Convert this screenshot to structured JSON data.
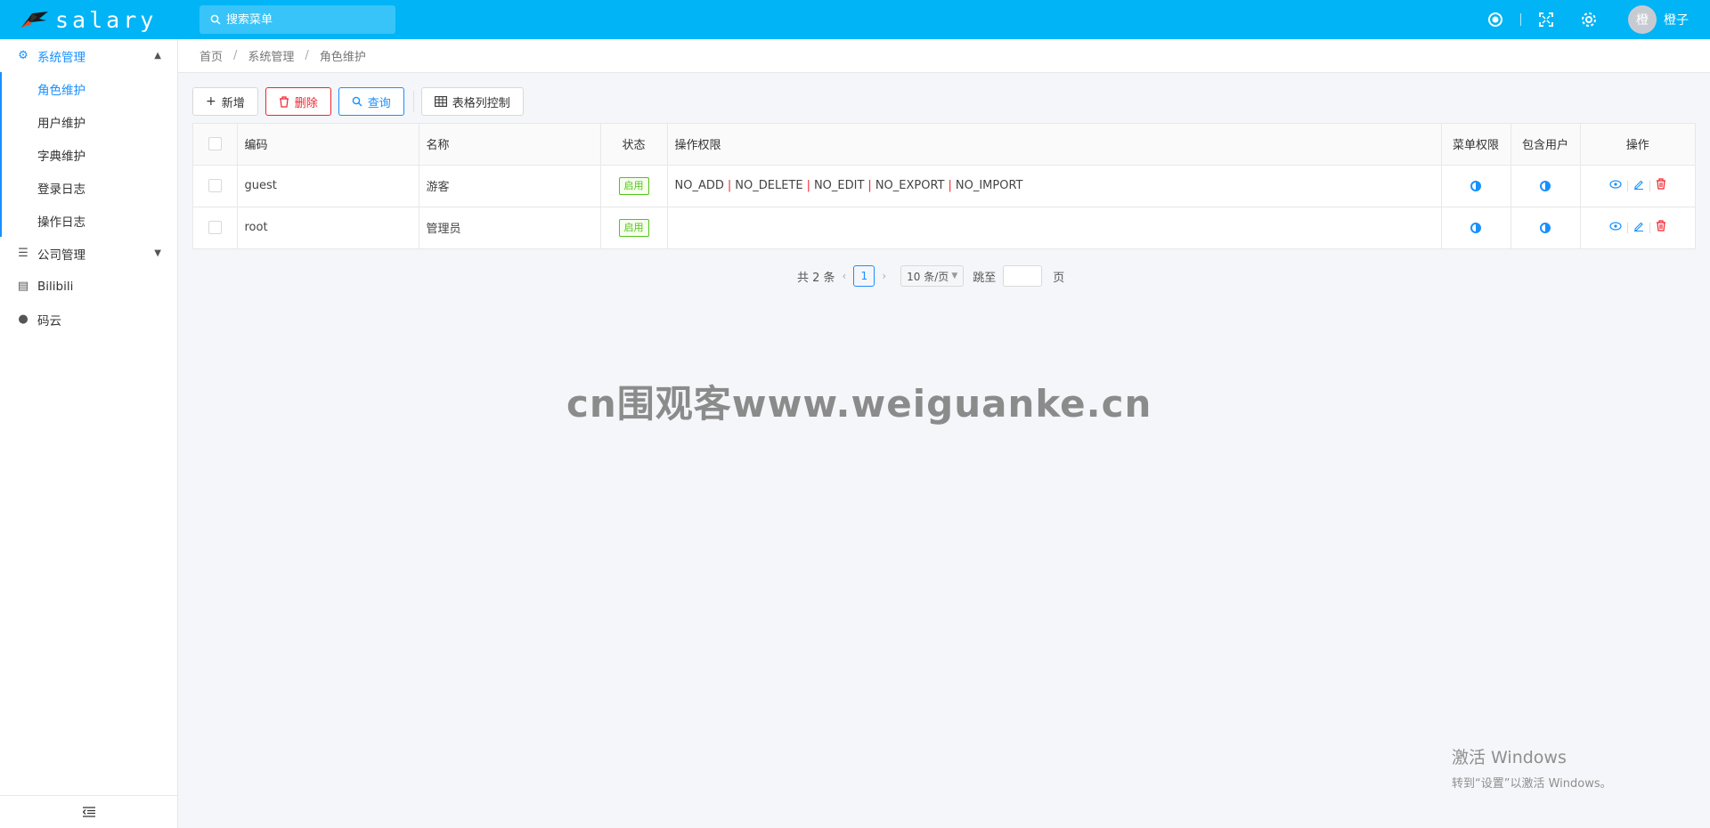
{
  "app": {
    "logo_text": "salary"
  },
  "header": {
    "search_placeholder": "搜索菜单",
    "username": "橙子",
    "avatar_text": "橙",
    "icons": [
      "radio-icon",
      "fullscreen-icon",
      "gear-icon"
    ]
  },
  "sidebar": {
    "group_system": "系统管理",
    "sub_items": [
      "角色维护",
      "用户维护",
      "字典维护",
      "登录日志",
      "操作日志"
    ],
    "group_company": "公司管理",
    "link_bilibili": "Bilibili",
    "link_gitee": "码云"
  },
  "breadcrumb": [
    "首页",
    "系统管理",
    "角色维护"
  ],
  "toolbar": {
    "add": "新增",
    "delete": "删除",
    "query": "查询",
    "columns": "表格列控制"
  },
  "table": {
    "headers": [
      "编码",
      "名称",
      "状态",
      "操作权限",
      "菜单权限",
      "包含用户",
      "操作"
    ],
    "rows": [
      {
        "code": "guest",
        "name": "游客",
        "status": "启用",
        "perms": [
          "NO_ADD",
          "NO_DELETE",
          "NO_EDIT",
          "NO_EXPORT",
          "NO_IMPORT"
        ]
      },
      {
        "code": "root",
        "name": "管理员",
        "status": "启用",
        "perms": []
      }
    ],
    "perm_separator": "|"
  },
  "pagination": {
    "total_text": "共 2 条",
    "current_page": "1",
    "page_size": "10 条/页",
    "jump_label": "跳至",
    "page_label": "页"
  },
  "overlay": {
    "watermark": "cn围观客www.weiguanke.cn",
    "activate_title": "激活 Windows",
    "activate_sub": "转到“设置”以激活 Windows。"
  },
  "colors": {
    "header_bg": "#00b4f6",
    "primary": "#1890ff",
    "danger": "#f5222d",
    "success": "#52c41a"
  }
}
